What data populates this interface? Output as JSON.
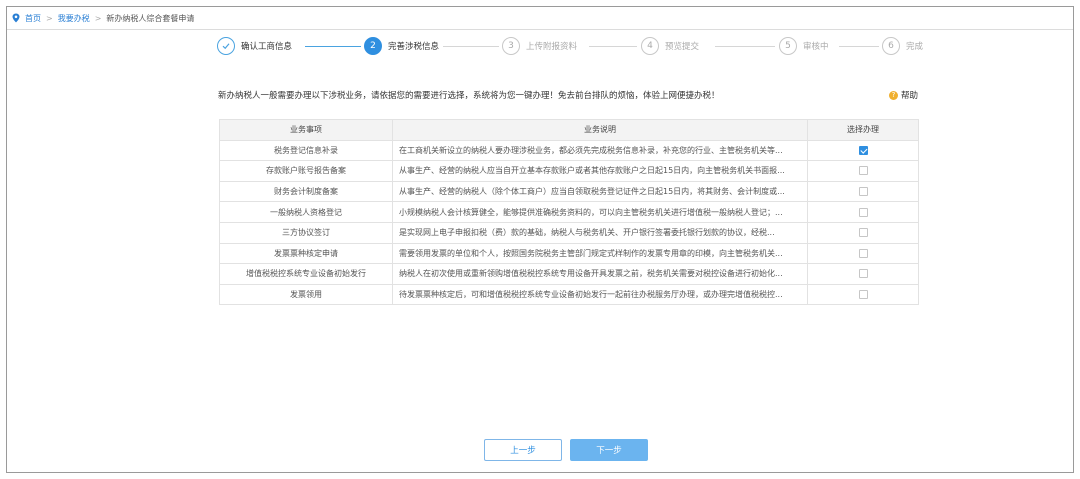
{
  "breadcrumb": {
    "home": "首页",
    "section": "我要办税",
    "current": "新办纳税人综合套餐申请"
  },
  "steps": [
    {
      "number": "",
      "label": "确认工商信息",
      "state": "done"
    },
    {
      "number": "2",
      "label": "完善涉税信息",
      "state": "active"
    },
    {
      "number": "3",
      "label": "上传附报资料",
      "state": "pending"
    },
    {
      "number": "4",
      "label": "预览提交",
      "state": "pending"
    },
    {
      "number": "5",
      "label": "审核中",
      "state": "pending"
    },
    {
      "number": "6",
      "label": "完成",
      "state": "pending"
    }
  ],
  "intro": {
    "text": "新办纳税人一般需要办理以下涉税业务，请依据您的需要进行选择，系统将为您一键办理！免去前台排队的烦恼，体验上网便捷办税！",
    "help_label": "帮助"
  },
  "table": {
    "headers": [
      "业务事项",
      "业务说明",
      "选择办理"
    ],
    "rows": [
      {
        "name": "税务登记信息补录",
        "desc": "在工商机关新设立的纳税人要办理涉税业务，都必须先完成税务信息补录，补充您的行业、主管税务机关等...",
        "checked": true
      },
      {
        "name": "存款账户账号报告备案",
        "desc": "从事生产、经营的纳税人应当自开立基本存款账户或者其他存款账户之日起15日内，向主管税务机关书面报...",
        "checked": false
      },
      {
        "name": "财务会计制度备案",
        "desc": "从事生产、经营的纳税人（除个体工商户）应当自领取税务登记证件之日起15日内，将其财务、会计制度或...",
        "checked": false
      },
      {
        "name": "一般纳税人资格登记",
        "desc": "小规模纳税人会计核算健全，能够提供准确税务资料的，可以向主管税务机关进行增值税一般纳税人登记；...",
        "checked": false
      },
      {
        "name": "三方协议签订",
        "desc": "是实现网上电子申报扣税（费）款的基础，纳税人与税务机关、开户银行签署委托银行划款的协议，经税...",
        "checked": false
      },
      {
        "name": "发票票种核定申请",
        "desc": "需要领用发票的单位和个人，按照国务院税务主管部门规定式样制作的发票专用章的印模，向主管税务机关...",
        "checked": false
      },
      {
        "name": "增值税税控系统专业设备初始发行",
        "desc": "纳税人在初次使用或重新领购增值税税控系统专用设备开具发票之前，税务机关需要对税控设备进行初始化...",
        "checked": false
      },
      {
        "name": "发票领用",
        "desc": "待发票票种核定后，可和增值税税控系统专业设备初始发行一起前往办税服务厅办理，或办理完增值税税控...",
        "checked": false
      }
    ]
  },
  "buttons": {
    "prev": "上一步",
    "next": "下一步"
  },
  "colors": {
    "accent": "#2f8fe0",
    "next_button": "#6bb4ef",
    "help_icon": "#f0b030"
  }
}
